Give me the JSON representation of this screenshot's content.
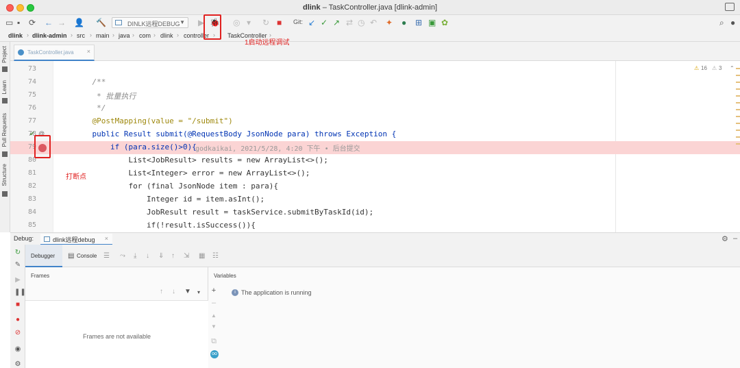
{
  "window": {
    "title_project": "dlink",
    "title_file": "TaskController.java [dlink-admin]"
  },
  "toolbar": {
    "run_config": "DINLK远程DEBUG",
    "git_label": "Git:"
  },
  "breadcrumb": [
    "dlink",
    "dlink-admin",
    "src",
    "main",
    "java",
    "com",
    "dlink",
    "controller",
    "TaskController"
  ],
  "left_tools": [
    "Project",
    "Learn",
    "Pull Requests",
    "Structure"
  ],
  "editor": {
    "tab_label": "TaskController.java",
    "warnings": "16",
    "weak_warnings": "3",
    "lines": [
      {
        "num": "73",
        "code": ""
      },
      {
        "num": "74",
        "code": "    /**"
      },
      {
        "num": "75",
        "code": "     * 批量执行"
      },
      {
        "num": "76",
        "code": "     */"
      },
      {
        "num": "77",
        "code": "    @PostMapping(value = \"/submit\")"
      },
      {
        "num": "78",
        "code": "    public Result submit(@RequestBody JsonNode para) throws Exception {"
      },
      {
        "num": "79",
        "code": "        if (para.size()>0){"
      },
      {
        "num": "80",
        "code": "            List<JobResult> results = new ArrayList<>();"
      },
      {
        "num": "81",
        "code": "            List<Integer> error = new ArrayList<>();"
      },
      {
        "num": "82",
        "code": "            for (final JsonNode item : para){"
      },
      {
        "num": "83",
        "code": "                Integer id = item.asInt();"
      },
      {
        "num": "84",
        "code": "                JobResult result = taskService.submitByTaskId(id);"
      },
      {
        "num": "85",
        "code": "                if(!result.isSuccess()){"
      }
    ],
    "blame": "godkaikai, 2021/5/28, 4:20 下午 • 后台提交"
  },
  "annotations": {
    "start_remote_debug": "1启动远程调试",
    "set_breakpoint": "打断点"
  },
  "debug": {
    "title": "Debug:",
    "tab_label": "dlink远程debug",
    "subtab_debugger": "Debugger",
    "subtab_console": "Console",
    "frames_title": "Frames",
    "frames_empty": "Frames are not available",
    "variables_title": "Variables",
    "variables_msg": "The application is running"
  },
  "colors": {
    "breakpoint": "#db5860",
    "highlight_line": "#fbd4d4",
    "annotation_red": "#e0201f",
    "accent": "#4083c9"
  }
}
